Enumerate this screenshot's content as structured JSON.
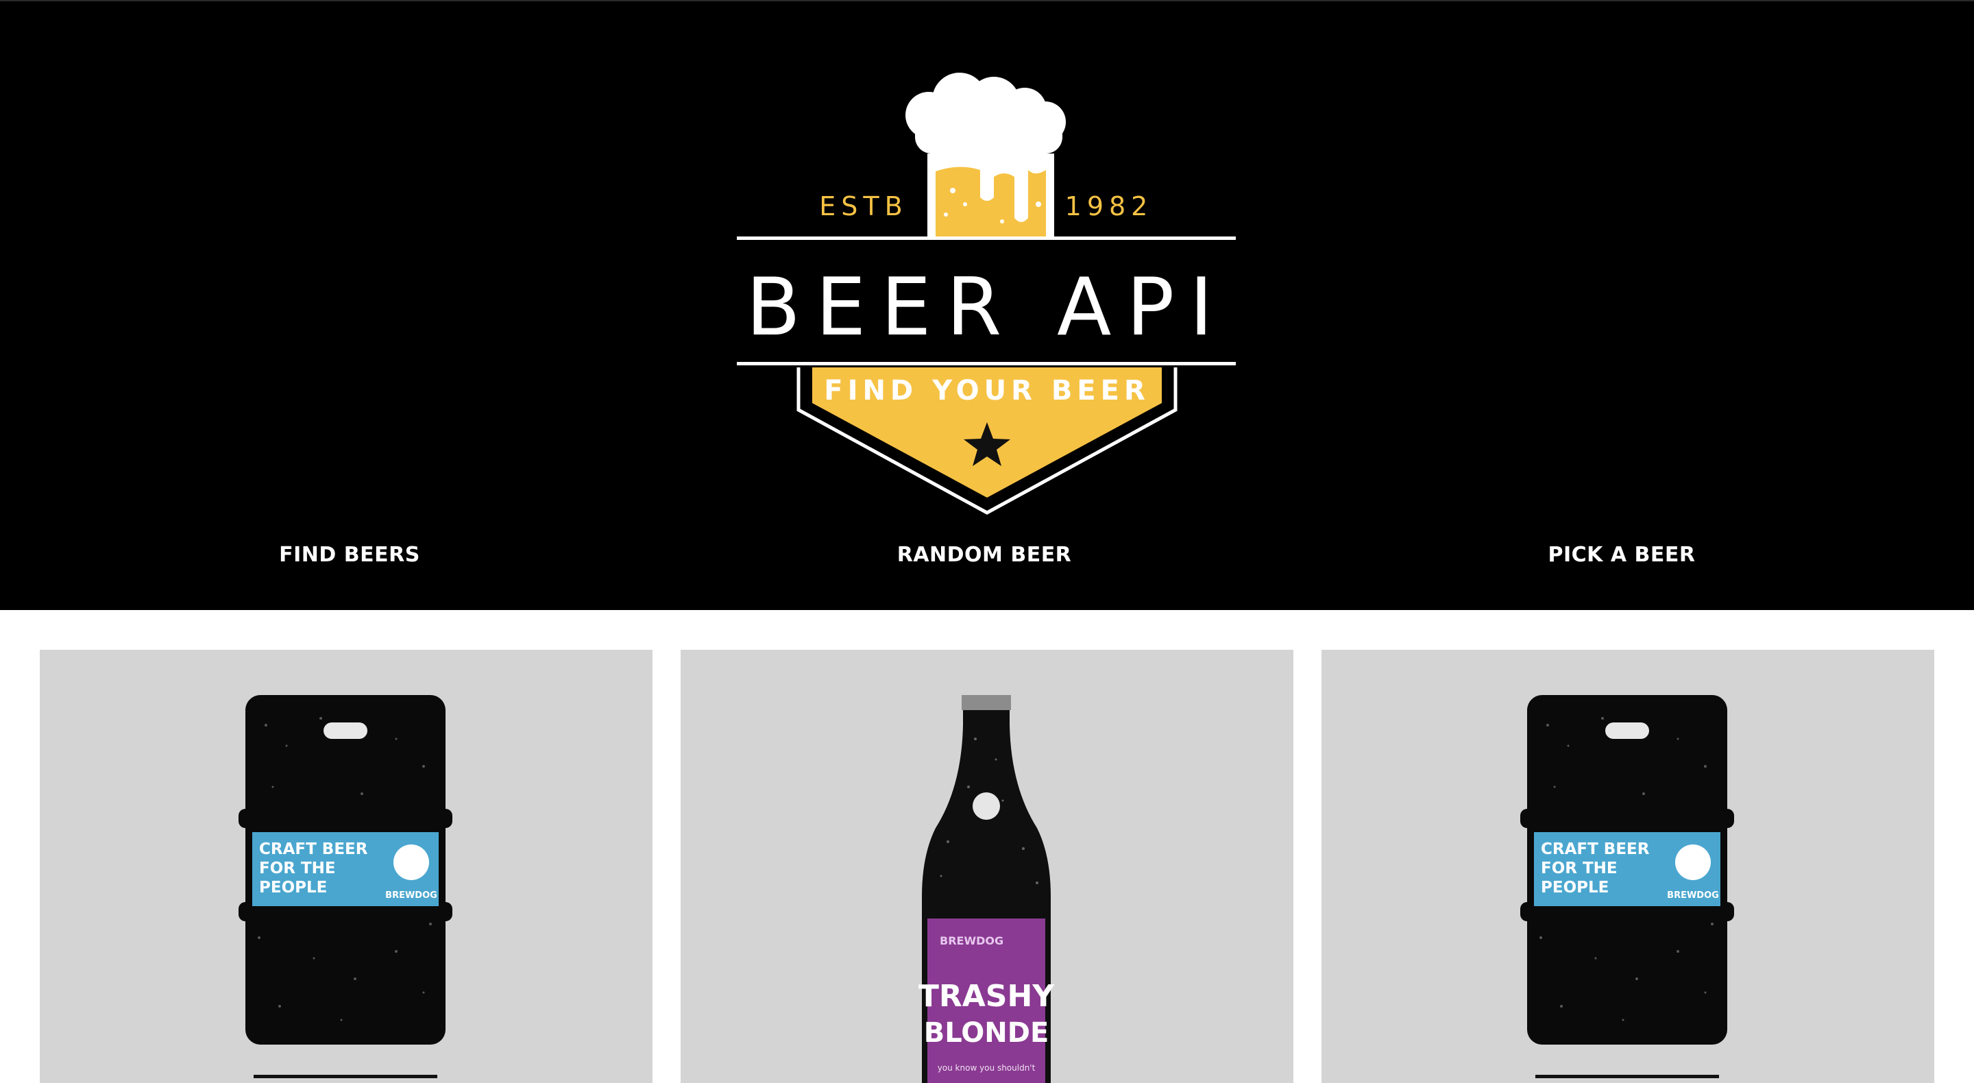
{
  "header": {
    "logo": {
      "estb": "ESTB",
      "year": "1982",
      "title": "BEER API",
      "tagline": "FIND YOUR BEER"
    },
    "nav": [
      {
        "label": "FIND BEERS"
      },
      {
        "label": "RANDOM BEER"
      },
      {
        "label": "PICK A BEER"
      }
    ]
  },
  "cards": [
    {
      "type": "keg",
      "label_lines": [
        "CRAFT BEER",
        "FOR THE",
        "PEOPLE"
      ],
      "brand": "BREWDOG"
    },
    {
      "type": "bottle",
      "label_lines": [
        "TRASHY",
        "BLONDE"
      ],
      "brand": "BREWDOG",
      "small_text": "you know you shouldn't"
    },
    {
      "type": "keg",
      "label_lines": [
        "CRAFT BEER",
        "FOR THE",
        "PEOPLE"
      ],
      "brand": "BREWDOG"
    }
  ],
  "colors": {
    "header_bg": "#000000",
    "accent_yellow": "#f6c244",
    "card_bg": "#d4d4d4",
    "keg_label_blue": "#4aa6cf",
    "bottle_label_purple": "#8a3a92"
  }
}
